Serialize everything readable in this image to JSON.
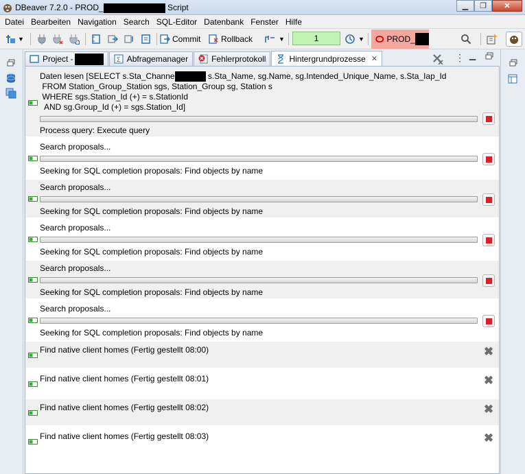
{
  "window": {
    "title_prefix": "DBeaver 7.2.0 - PROD_",
    "title_suffix": " Script",
    "minimize_icon": "minimize-icon",
    "maximize_icon": "maximize-icon",
    "close_icon": "close-icon"
  },
  "menu": {
    "items": [
      {
        "label": "Datei",
        "mnemonic": "D"
      },
      {
        "label": "Bearbeiten",
        "mnemonic": "B"
      },
      {
        "label": "Navigation",
        "mnemonic": "N"
      },
      {
        "label": "Search",
        "mnemonic": "S"
      },
      {
        "label": "SQL-Editor",
        "mnemonic": "S"
      },
      {
        "label": "Datenbank",
        "mnemonic": "D"
      },
      {
        "label": "Fenster",
        "mnemonic": "F"
      },
      {
        "label": "Hilfe",
        "mnemonic": "H"
      }
    ]
  },
  "toolbar": {
    "commit_label": "Commit",
    "rollback_label": "Rollback",
    "transaction_count": "1",
    "connection_label": "PROD_",
    "connection_color": "#f4a79f",
    "transaction_color": "#c2f2b4"
  },
  "tabs": [
    {
      "label": "Project - ",
      "icon": "project-icon",
      "active": false
    },
    {
      "label": "Abfragemanager",
      "icon": "query-manager-icon",
      "active": false
    },
    {
      "label": "Fehlerprotokoll",
      "icon": "error-log-icon",
      "active": false
    },
    {
      "label": "Hintergrundprozesse",
      "icon": "background-jobs-icon",
      "active": true
    }
  ],
  "jobs": [
    {
      "lines": [
        "Daten lesen [SELECT s.Sta_Channe",
        " FROM Station_Group_Station sgs, Station_Group sg, Station s",
        " WHERE sgs.Station_Id (+) = s.StationId",
        "  AND sg.Group_Id (+) = sgs.Station_Id]"
      ],
      "line1_tail": " s.Sta_Name, sg.Name, sg.Intended_Unique_Name, s.Sta_Iap_Id",
      "status": "Process query: Execute query"
    },
    {
      "title": "Search proposals...",
      "status": "Seeking for SQL completion proposals: Find objects by name"
    },
    {
      "title": "Search proposals...",
      "status": "Seeking for SQL completion proposals: Find objects by name"
    },
    {
      "title": "Search proposals...",
      "status": "Seeking for SQL completion proposals: Find objects by name"
    },
    {
      "title": "Search proposals...",
      "status": "Seeking for SQL completion proposals: Find objects by name"
    },
    {
      "title": "Search proposals...",
      "status": "Seeking for SQL completion proposals: Find objects by name"
    },
    {
      "title": "Find native client homes (Fertig gestellt 08:00)"
    },
    {
      "title": "Find native client homes (Fertig gestellt 08:01)"
    },
    {
      "title": "Find native client homes (Fertig gestellt 08:02)"
    },
    {
      "title": "Find native client homes (Fertig gestellt 08:03)"
    }
  ]
}
